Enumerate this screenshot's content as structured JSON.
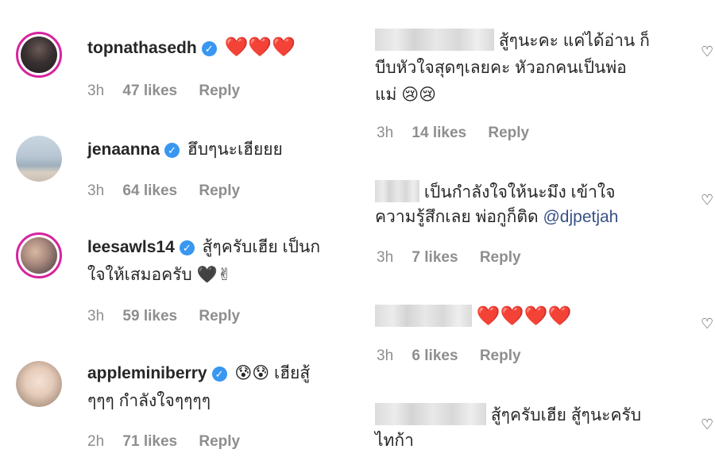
{
  "left_comments": [
    {
      "username": "topnathasedh",
      "text": "❤️❤️❤️",
      "time": "3h",
      "likes": "47 likes",
      "reply": "Reply"
    },
    {
      "username": "jenaanna",
      "text": "ฮึบๆนะเฮียยย",
      "time": "3h",
      "likes": "64 likes",
      "reply": "Reply"
    },
    {
      "username": "leesawls14",
      "text_line1": "สู้ๆครับเฮีย เป็นก",
      "text_line2": "ใจให้เสมอครับ 🖤✌",
      "time": "3h",
      "likes": "59 likes",
      "reply": "Reply"
    },
    {
      "username": "appleminiberry",
      "text_line1": "😰😰 เฮียสู้",
      "text_line2": "ๆๆๆ กำลังใจๆๆๆๆ",
      "time": "2h",
      "likes": "71 likes",
      "reply": "Reply"
    }
  ],
  "right_comments": [
    {
      "line1": "สู้ๆนะคะ แค่ได้อ่าน ก็",
      "line2": "บีบหัวใจสุดๆเลยคะ หัวอกคนเป็นพ่อ",
      "line3": "แม่ 😢😢",
      "time": "3h",
      "likes": "14 likes",
      "reply": "Reply"
    },
    {
      "line1": "เป็นกำลังใจให้นะมึง เข้าใจ",
      "line2": "ความรู้สึกเลย พ่อกูก็ติด",
      "mention": "@djpetjah",
      "time": "3h",
      "likes": "7 likes",
      "reply": "Reply"
    },
    {
      "line1": "❤️❤️❤️❤️",
      "time": "3h",
      "likes": "6 likes",
      "reply": "Reply"
    },
    {
      "line1": "สู้ๆครับเฮีย สู้ๆนะครับ",
      "line2": "ไทก้า"
    }
  ],
  "icons": {
    "verified": "✓",
    "like_outline": "♡"
  },
  "colors": {
    "text": "#262626",
    "meta": "#8e8e8e",
    "verified": "#3897f0",
    "mention": "#385185",
    "heart": "#e0102c"
  }
}
